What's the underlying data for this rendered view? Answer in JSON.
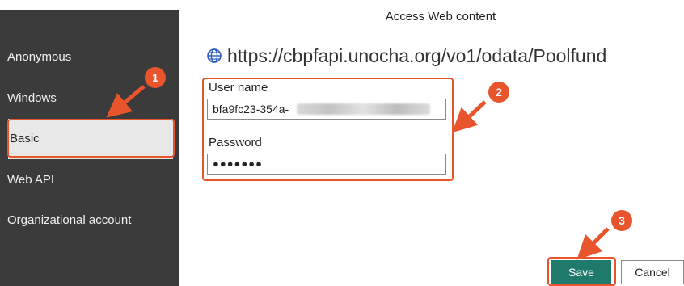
{
  "dialog": {
    "title": "Access Web content"
  },
  "sidebar": {
    "items": [
      {
        "label": "Anonymous"
      },
      {
        "label": "Windows"
      },
      {
        "label": "Basic"
      },
      {
        "label": "Web API"
      },
      {
        "label": "Organizational account"
      }
    ],
    "selected_index": 2
  },
  "main": {
    "url_icon": "globe-icon",
    "url": "https://cbpfapi.unocha.org/vo1/odata/Poolfund",
    "username": {
      "label": "User name",
      "value": "bfa9fc23-354a-"
    },
    "password": {
      "label": "Password",
      "value": "●●●●●●●"
    }
  },
  "buttons": {
    "save": "Save",
    "cancel": "Cancel"
  },
  "annotations": {
    "badges": [
      "1",
      "2",
      "3"
    ],
    "color": "#e8542c"
  },
  "colors": {
    "sidebar_bg": "#3b3b3b",
    "selected_bg": "#e8e8e8",
    "save_bg": "#1f7a6b"
  }
}
